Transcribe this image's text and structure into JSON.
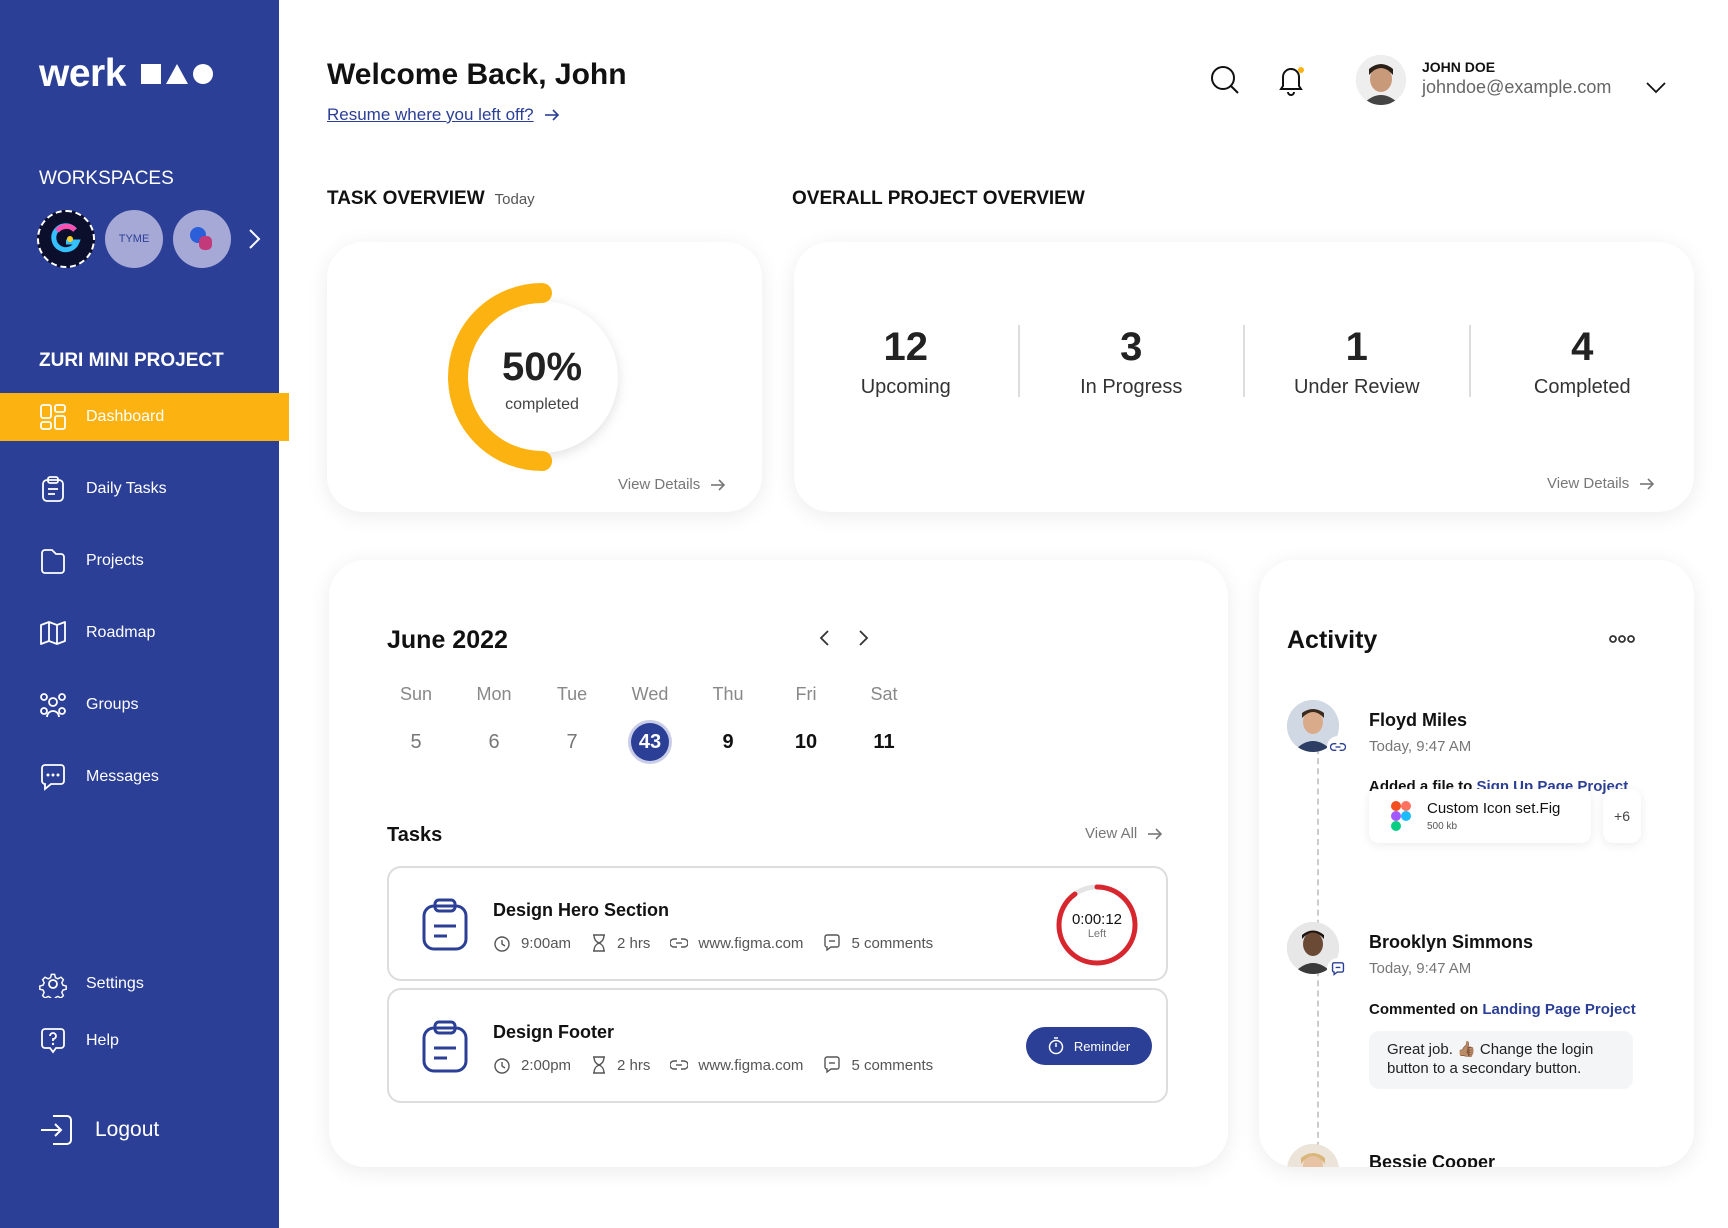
{
  "brand": {
    "name": "werk"
  },
  "sidebar": {
    "workspaces_title": "WORKSPACES",
    "workspaces": [
      "G",
      "TYME",
      "B"
    ],
    "project_title": "ZURI MINI PROJECT",
    "nav": [
      {
        "label": "Dashboard",
        "icon": "dashboard-icon",
        "active": true
      },
      {
        "label": "Daily Tasks",
        "icon": "clipboard-icon"
      },
      {
        "label": "Projects",
        "icon": "folder-icon"
      },
      {
        "label": "Roadmap",
        "icon": "map-icon"
      },
      {
        "label": "Groups",
        "icon": "groups-icon"
      },
      {
        "label": "Messages",
        "icon": "message-icon"
      }
    ],
    "bottom_nav": [
      {
        "label": "Settings",
        "icon": "gear-icon"
      },
      {
        "label": "Help",
        "icon": "help-icon"
      }
    ],
    "logout": "Logout"
  },
  "header": {
    "welcome": "Welcome Back, John",
    "resume": "Resume where you left off?",
    "user_name": "JOHN DOE",
    "user_email": "johndoe@example.com"
  },
  "task_overview": {
    "title": "TASK OVERVIEW",
    "subtitle": "Today",
    "percent": "50%",
    "percent_value": 0.5,
    "label": "completed",
    "view_details": "View Details"
  },
  "project_overview": {
    "title": "OVERALL PROJECT OVERVIEW",
    "stats": [
      {
        "value": "12",
        "label": "Upcoming"
      },
      {
        "value": "3",
        "label": "In Progress"
      },
      {
        "value": "1",
        "label": "Under Review"
      },
      {
        "value": "4",
        "label": "Completed"
      }
    ],
    "view_details": "View Details"
  },
  "calendar": {
    "month": "June 2022",
    "days": [
      "Sun",
      "Mon",
      "Tue",
      "Wed",
      "Thu",
      "Fri",
      "Sat"
    ],
    "dates": [
      "5",
      "6",
      "7",
      "43",
      "9",
      "10",
      "11"
    ],
    "today_index": 3
  },
  "tasks": {
    "title": "Tasks",
    "view_all": "View All",
    "items": [
      {
        "name": "Design Hero Section",
        "time": "9:00am",
        "duration": "2 hrs",
        "link": "www.figma.com",
        "comments": "5 comments",
        "timer": "0:00:12",
        "timer_label": "Left",
        "timer_progress": 0.9
      },
      {
        "name": "Design Footer",
        "time": "2:00pm",
        "duration": "2 hrs",
        "link": "www.figma.com",
        "comments": "5 comments",
        "action": "Reminder"
      }
    ]
  },
  "activity": {
    "title": "Activity",
    "items": [
      {
        "name": "Floyd Miles",
        "time": "Today, 9:47 AM",
        "action": "Added a file to",
        "target": "Sign Up Page Project",
        "file_name": "Custom Icon set.Fig",
        "file_size": "500 kb",
        "more": "+6"
      },
      {
        "name": "Brooklyn Simmons",
        "time": "Today, 9:47 AM",
        "action": "Commented on",
        "target": "Landing Page Project",
        "comment_a": "Great job. 👍🏽 Change the login",
        "comment_b": "button to a secondary button."
      },
      {
        "name": "Bessie Cooper"
      }
    ]
  },
  "colors": {
    "primary": "#2b3f96",
    "accent": "#fcb312",
    "danger": "#d7262e"
  }
}
